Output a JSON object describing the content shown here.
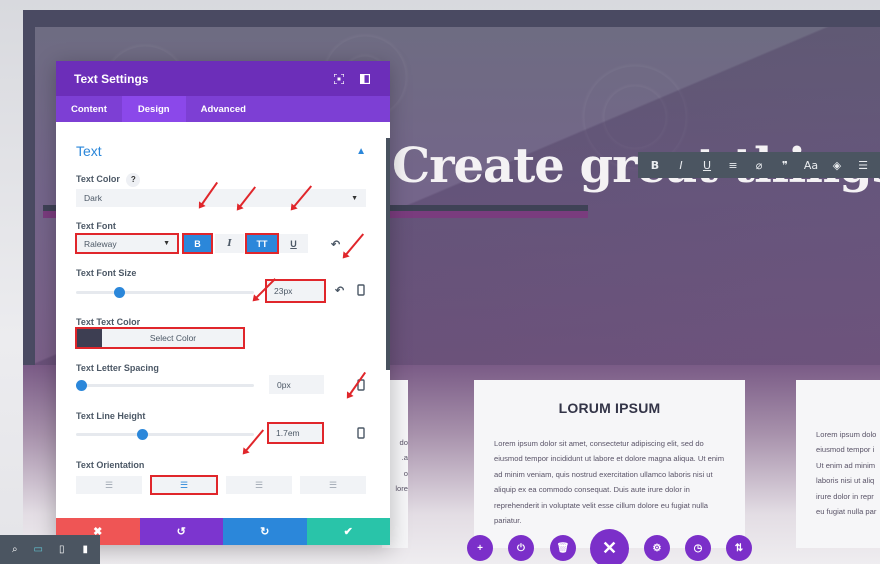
{
  "panel": {
    "title": "Text Settings",
    "header_icons": [
      "focus-icon",
      "sidebar-toggle-icon"
    ],
    "tabs": [
      {
        "label": "Content",
        "active": false
      },
      {
        "label": "Design",
        "active": true
      },
      {
        "label": "Advanced",
        "active": false
      }
    ],
    "section_title": "Text",
    "text_color": {
      "label": "Text Color",
      "help": "?",
      "value": "Dark"
    },
    "text_font": {
      "label": "Text Font",
      "value": "Raleway",
      "styles": [
        {
          "label": "B",
          "active": true
        },
        {
          "label": "I",
          "active": false
        },
        {
          "label": "TT",
          "active": true
        },
        {
          "label": "U",
          "active": false
        }
      ]
    },
    "font_size": {
      "label": "Text Font Size",
      "value": "23px",
      "slider_fraction": 0.23
    },
    "text_text_color": {
      "label": "Text Text Color",
      "button": "Select Color",
      "swatch": "#3d3e52"
    },
    "letter_spacing": {
      "label": "Text Letter Spacing",
      "value": "0px",
      "slider_fraction": 0.0
    },
    "line_height": {
      "label": "Text Line Height",
      "value": "1.7em",
      "slider_fraction": 0.36
    },
    "orientation": {
      "label": "Text Orientation",
      "options": [
        "left",
        "center",
        "right",
        "justified"
      ],
      "selected": "center"
    },
    "footer": [
      {
        "name": "discard",
        "glyph": "✖",
        "color": "#ef5555"
      },
      {
        "name": "undo",
        "glyph": "↺",
        "color": "#7c35cf"
      },
      {
        "name": "redo",
        "glyph": "↻",
        "color": "#2b87da"
      },
      {
        "name": "save",
        "glyph": "✔",
        "color": "#29c4a9"
      }
    ]
  },
  "canvas": {
    "heading": "Create great things",
    "format_toolbar": [
      "B",
      "I",
      "U",
      "≡",
      "⌀",
      "❞",
      "Aa",
      "◈",
      "☰"
    ],
    "cards": {
      "title": "LORUM IPSUM",
      "body": "Lorem ipsum dolor sit amet, consectetur adipiscing elit, sed do eiusmod tempor incididunt ut labore et dolore magna aliqua. Ut enim ad minim veniam, quis nostrud exercitation ullamco laboris nisi ut aliquip ex ea commodo consequat. Duis aute irure dolor in reprehenderit in voluptate velit esse cillum dolore eu fugiat nulla pariatur.",
      "left_fragments": [
        "do",
        "a.",
        "o",
        "",
        "lore"
      ],
      "right_lines": [
        "Lorem ipsum dolo",
        "eiusmod tempor i",
        "Ut enim ad minim",
        "laboris nisi ut aliq",
        "irure dolor in repr",
        "eu fugiat nulla par"
      ]
    }
  },
  "responsive_bar": [
    {
      "name": "zoom",
      "glyph": "⌕"
    },
    {
      "name": "desktop",
      "glyph": "▭",
      "active": true
    },
    {
      "name": "tablet",
      "glyph": "▯"
    },
    {
      "name": "phone",
      "glyph": "▮"
    }
  ],
  "page_actions": [
    {
      "name": "add",
      "glyph": "+"
    },
    {
      "name": "power",
      "glyph": "⏻"
    },
    {
      "name": "trash",
      "glyph": "🗑"
    },
    {
      "name": "close",
      "glyph": "✕"
    },
    {
      "name": "settings",
      "glyph": "⚙"
    },
    {
      "name": "history",
      "glyph": "◷"
    },
    {
      "name": "sort",
      "glyph": "⇅"
    }
  ],
  "colors": {
    "panel_header": "#6c2eb9",
    "tabs_bg": "#7d3fd4",
    "accent_blue": "#2b87da",
    "highlight_red": "#e0262b"
  }
}
